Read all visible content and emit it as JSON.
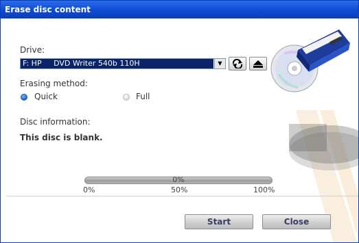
{
  "window": {
    "title": "Erase disc content"
  },
  "drive": {
    "label": "Drive:",
    "selected": "F: HP     DVD Writer 540b 110H",
    "dropdown_arrow": "▼",
    "refresh_icon": "refresh-icon",
    "eject_icon": "eject-icon"
  },
  "erasing": {
    "label": "Erasing method:",
    "options": [
      {
        "label": "Quick",
        "selected": true
      },
      {
        "label": "Full",
        "selected": false
      }
    ]
  },
  "disc_info": {
    "label": "Disc information:",
    "value": "This disc is blank."
  },
  "progress": {
    "percent": 0,
    "text": "0%",
    "ticks": [
      "0%",
      "50%",
      "100%"
    ]
  },
  "buttons": {
    "start": "Start",
    "close": "Close"
  },
  "colors": {
    "title_bar": "#0d4bd2",
    "selection": "#0a246a",
    "accent": "#1a5fcf"
  }
}
